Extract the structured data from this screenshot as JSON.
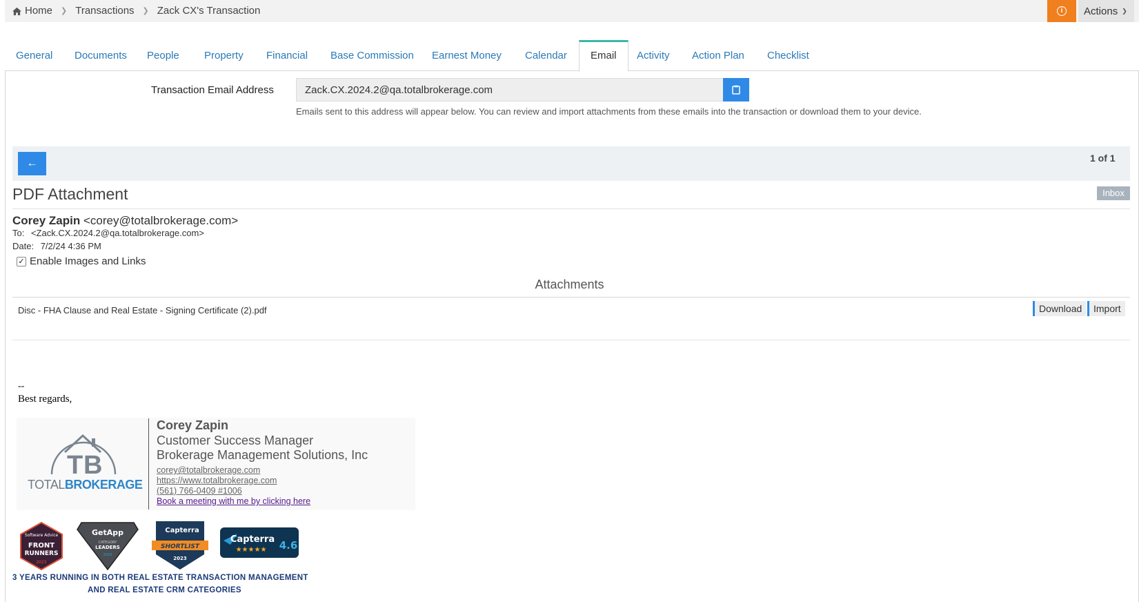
{
  "breadcrumb": {
    "home": "Home",
    "transactions": "Transactions",
    "current": "Zack CX's Transaction"
  },
  "header": {
    "info_icon": "info-icon",
    "actions_label": "Actions"
  },
  "tabs": [
    {
      "label": "General"
    },
    {
      "label": "Documents"
    },
    {
      "label": "People"
    },
    {
      "label": "Property"
    },
    {
      "label": "Financial"
    },
    {
      "label": "Base Commission"
    },
    {
      "label": "Earnest Money"
    },
    {
      "label": "Calendar"
    },
    {
      "label": "Email",
      "active": true
    },
    {
      "label": "Activity"
    },
    {
      "label": "Action Plan"
    },
    {
      "label": "Checklist"
    }
  ],
  "email_settings": {
    "label": "Transaction Email Address",
    "address": "Zack.CX.2024.2@qa.totalbrokerage.com",
    "help": "Emails sent to this address will appear below. You can review and import attachments from these emails into the transaction or download them to your device."
  },
  "pager": {
    "back_label": "←",
    "status": "1 of 1"
  },
  "message": {
    "subject": "PDF Attachment",
    "folder_badge": "Inbox",
    "from_name": "Corey Zapin",
    "from_email": "<corey@totalbrokerage.com>",
    "to_key": "To:",
    "to_value": "<Zack.CX.2024.2@qa.totalbrokerage.com>",
    "date_key": "Date:",
    "date_value": "7/2/24 4:36 PM",
    "enable_images_label": "Enable Images and Links",
    "enable_images_checked": true
  },
  "attachments": {
    "title": "Attachments",
    "items": [
      {
        "filename": "Disc - FHA Clause and Real Estate - Signing Certificate (2).pdf",
        "download_label": "Download",
        "import_label": "Import"
      }
    ]
  },
  "signature": {
    "dash": "--",
    "regards": "Best regards,",
    "name": "Corey Zapin",
    "title": "Customer Success Manager",
    "company": "Brokerage Management Solutions, Inc",
    "email": "corey@totalbrokerage.com",
    "website": "https://www.totalbrokerage.com",
    "phone": "(561) 766-0409 #1006",
    "meeting_link": "Book a meeting with me by clicking here",
    "logo_word1": "TOTAL",
    "logo_word2": "BROKERAGE",
    "badges": [
      {
        "name": "software-advice-front-runners-badge",
        "line1": "Software Advice",
        "line2": "FRONT",
        "line3": "RUNNERS",
        "year": "2023"
      },
      {
        "name": "getapp-category-leaders-badge",
        "line1": "GetApp",
        "line2": "CATEGORY",
        "line3": "LEADERS",
        "year": "2023"
      },
      {
        "name": "capterra-shortlist-badge",
        "line1": "Capterra",
        "line2": "SHORTLIST",
        "year": "2023"
      },
      {
        "name": "capterra-rating-badge",
        "line1": "Capterra",
        "rating": "4.6"
      }
    ],
    "caption_line1": "3 YEARS RUNNING IN BOTH REAL ESTATE TRANSACTION MANAGEMENT",
    "caption_line2": "AND REAL ESTATE CRM CATEGORIES"
  },
  "colors": {
    "accent_blue": "#2e8ae6",
    "tab_active_border": "#3bb8a8",
    "info_orange": "#f07f1e"
  }
}
